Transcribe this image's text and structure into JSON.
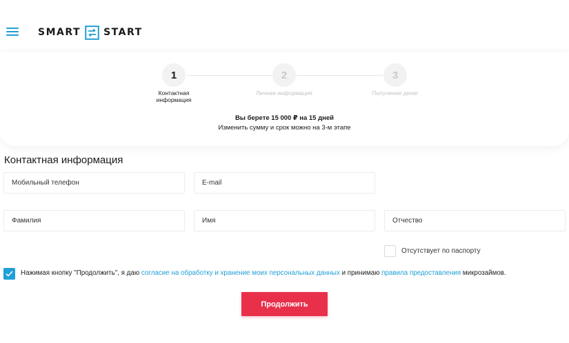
{
  "header": {
    "logo_left": "SMART",
    "logo_right": "START",
    "brand_color": "#1e9fd6"
  },
  "stepper": {
    "steps": [
      {
        "number": "1",
        "label_line1": "Контактная",
        "label_line2": "информация",
        "active": true
      },
      {
        "number": "2",
        "label_line1": "Личная информация",
        "label_line2": "",
        "active": false
      },
      {
        "number": "3",
        "label_line1": "Получение денег",
        "label_line2": "",
        "active": false
      }
    ],
    "loan_summary": "Вы берете 15 000 ₽ на 15 дней",
    "loan_note": "Изменить сумму и срок можно на 3-м этапе"
  },
  "form": {
    "title": "Контактная информация",
    "phone_placeholder": "Мобильный телефон",
    "email_placeholder": "E-mail",
    "lastname_placeholder": "Фамилия",
    "firstname_placeholder": "Имя",
    "middlename_placeholder": "Отчество",
    "no_middlename_label": "Отсутствует по паспорту",
    "no_middlename_checked": false,
    "consent_checked": true,
    "consent_prefix": "Нажимая кнопку \"Продолжить\", я даю",
    "consent_link1": "согласие на обработку и хранение моих персональных данных",
    "consent_middle": "и принимаю",
    "consent_link2": "правила предоставления",
    "consent_suffix": "микрозаймов.",
    "submit_label": "Продолжить",
    "submit_color": "#e8304b"
  }
}
